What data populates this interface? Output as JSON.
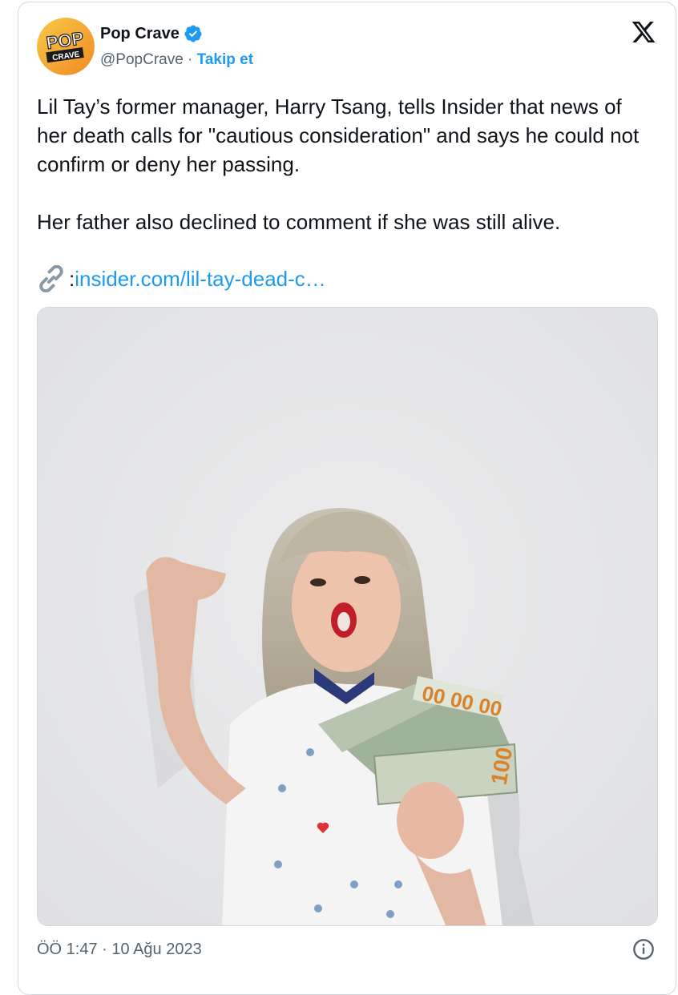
{
  "author": {
    "display_name": "Pop Crave",
    "handle": "@PopCrave",
    "separator": " · ",
    "follow_label": "Takip et",
    "avatar_text_top": "POP",
    "avatar_text_bottom": "CRAVE",
    "verified_icon": "verified-badge-icon"
  },
  "tweet": {
    "paragraph1": "Lil Tay’s former manager, Harry Tsang, tells Insider that news of her death calls for \"cautious consideration\" and says he could not confirm or deny her passing.",
    "paragraph2": "Her father also declined to comment if she was still alive.",
    "link_prefix": ": ",
    "link_text": "insider.com/lil-tay-dead-c…"
  },
  "footer": {
    "timestamp": "ÖÖ 1:47 · 10 Ağu 2023"
  },
  "colors": {
    "accent": "#1d9bf0",
    "text": "#0f1419",
    "muted": "#536471",
    "avatar_bg": "#f5a623"
  }
}
